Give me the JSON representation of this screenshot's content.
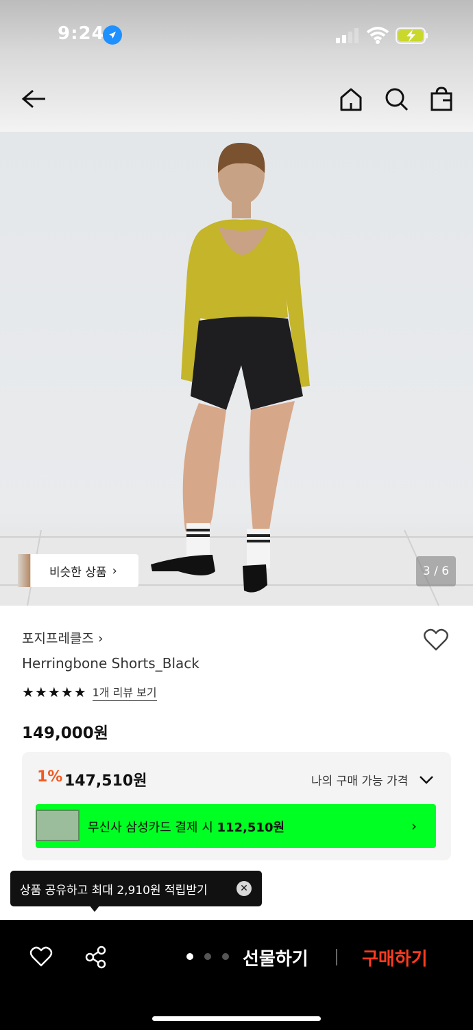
{
  "status_bar": {
    "time": "9:24"
  },
  "gallery": {
    "similar_label": "비슷한 상품",
    "page_indicator": "3 / 6"
  },
  "product": {
    "brand": "포지프레클즈",
    "name": "Herringbone Shorts_Black",
    "stars": "★★★★★",
    "review_link": "1개 리뷰 보기",
    "price": "149,000원"
  },
  "benefit": {
    "discount_rate": "1%",
    "discount_price": "147,510원",
    "my_price_label": "나의 구매 가능 가격",
    "card_text": "무신사 삼성카드 결제 시",
    "card_price": "112,510원"
  },
  "tooltip": {
    "text": "상품 공유하고 최대 2,910원 적립받기"
  },
  "bottom_bar": {
    "gift_label": "선물하기",
    "buy_label": "구매하기"
  },
  "colors": {
    "accent_orange": "#f15a22",
    "card_green": "#00ff22",
    "buy_red": "#ff3b1f"
  }
}
